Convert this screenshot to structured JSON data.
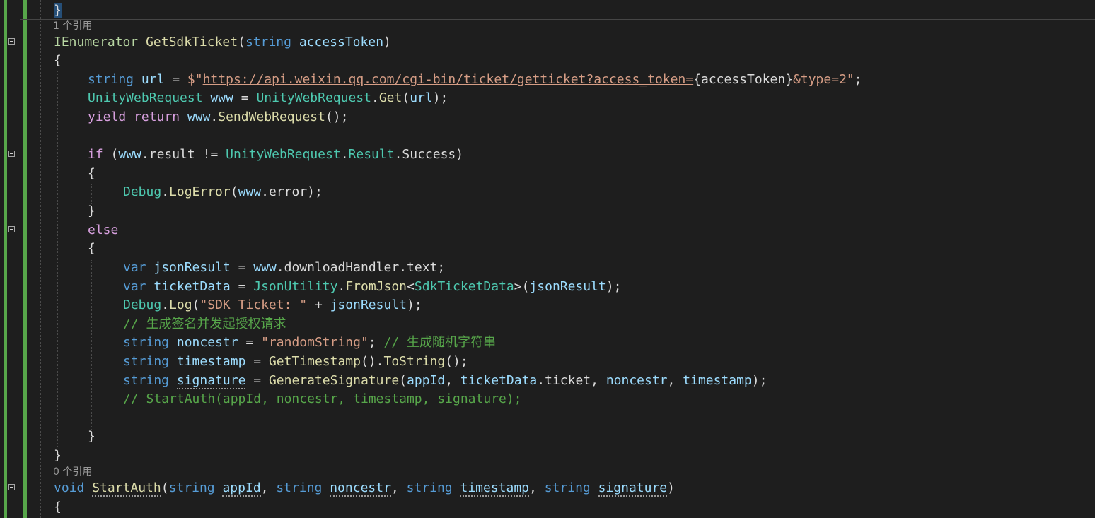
{
  "codelens": {
    "refs_get": "1 个引用",
    "refs_start": "0 个引用"
  },
  "code": {
    "l0_close": "}",
    "l1_iface": "IEnumerator",
    "l1_method": "GetSdkTicket",
    "l1_kw": "string",
    "l1_param": "accessToken",
    "l2": "{",
    "l3_kw": "string",
    "l3_var": "url",
    "l3_dollar": "$\"",
    "l3_url": "https://api.weixin.qq.com/cgi-bin/ticket/getticket?access_token=",
    "l3_interp": "{accessToken}",
    "l3_tail": "&type=2\"",
    "l4_type": "UnityWebRequest",
    "l4_var": "www",
    "l4_type2": "UnityWebRequest",
    "l4_method": "Get",
    "l4_arg": "url",
    "l5_ctl": "yield return",
    "l5_var": "www",
    "l5_method": "SendWebRequest",
    "l6_ctl": "if",
    "l6_var": "www",
    "l6_prop": "result",
    "l6_type": "UnityWebRequest",
    "l6_enum": "Result",
    "l6_member": "Success",
    "l7": "{",
    "l8_type": "Debug",
    "l8_method": "LogError",
    "l8_var": "www",
    "l8_prop": "error",
    "l9": "}",
    "l10_ctl": "else",
    "l11": "{",
    "l12_kw": "var",
    "l12_var": "jsonResult",
    "l12_var2": "www",
    "l12_prop": "downloadHandler",
    "l12_prop2": "text",
    "l13_kw": "var",
    "l13_var": "ticketData",
    "l13_type": "JsonUtility",
    "l13_method": "FromJson",
    "l13_generic": "SdkTicketData",
    "l13_arg": "jsonResult",
    "l14_type": "Debug",
    "l14_method": "Log",
    "l14_str": "\"SDK Ticket: \"",
    "l14_arg": "jsonResult",
    "l15_cmt": "// 生成签名并发起授权请求",
    "l16_kw": "string",
    "l16_var": "noncestr",
    "l16_str": "\"randomString\"",
    "l16_cmt": "// 生成随机字符串",
    "l17_kw": "string",
    "l17_var": "timestamp",
    "l17_method": "GetTimestamp",
    "l17_method2": "ToString",
    "l18_kw": "string",
    "l18_var": "signature",
    "l18_method": "GenerateSignature",
    "l18_a1": "appId",
    "l18_a2": "ticketData",
    "l18_a2p": "ticket",
    "l18_a3": "noncestr",
    "l18_a4": "timestamp",
    "l19_cmt": "// StartAuth(appId, noncestr, timestamp, signature);",
    "l21": "}",
    "l22": "}",
    "l23_kw": "void",
    "l23_method": "StartAuth",
    "l23_p1t": "string",
    "l23_p1": "appId",
    "l23_p2t": "string",
    "l23_p2": "noncestr",
    "l23_p3t": "string",
    "l23_p3": "timestamp",
    "l23_p4t": "string",
    "l23_p4": "signature",
    "l24": "{"
  },
  "colors": {
    "background": "#1e1e1e",
    "keyword": "#569cd6",
    "control": "#d8a0df",
    "type": "#4ec9b0",
    "method": "#dcdcaa",
    "variable": "#9cdcfe",
    "string": "#d69d85",
    "comment": "#57a64a",
    "change_bar": "#57a64a"
  }
}
